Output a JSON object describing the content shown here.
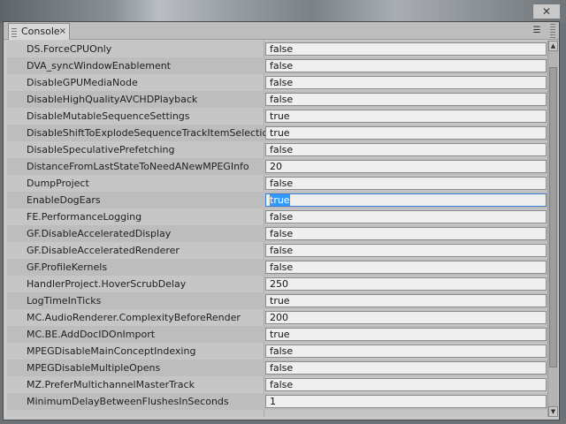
{
  "window": {
    "close_glyph": "✕"
  },
  "tab": {
    "label": "Console",
    "close_glyph": "×"
  },
  "panel_menu_glyph": "☰",
  "rows": [
    {
      "key": "DS.ForceCPUOnly",
      "value": "false"
    },
    {
      "key": "DVA_syncWindowEnablement",
      "value": "false"
    },
    {
      "key": "DisableGPUMediaNode",
      "value": "false"
    },
    {
      "key": "DisableHighQualityAVCHDPlayback",
      "value": "false"
    },
    {
      "key": "DisableMutableSequenceSettings",
      "value": "true"
    },
    {
      "key": "DisableShiftToExplodeSequenceTrackItemSelections",
      "value": "true"
    },
    {
      "key": "DisableSpeculativePrefetching",
      "value": "false"
    },
    {
      "key": "DistanceFromLastStateToNeedANewMPEGInfo",
      "value": "20"
    },
    {
      "key": "DumpProject",
      "value": "false"
    },
    {
      "key": "EnableDogEars",
      "value": "true",
      "selected": true
    },
    {
      "key": "FE.PerformanceLogging",
      "value": "false"
    },
    {
      "key": "GF.DisableAcceleratedDisplay",
      "value": "false"
    },
    {
      "key": "GF.DisableAcceleratedRenderer",
      "value": "false"
    },
    {
      "key": "GF.ProfileKernels",
      "value": "false"
    },
    {
      "key": "HandlerProject.HoverScrubDelay",
      "value": "250"
    },
    {
      "key": "LogTimeInTicks",
      "value": "true"
    },
    {
      "key": "MC.AudioRenderer.ComplexityBeforeRender",
      "value": "200"
    },
    {
      "key": "MC.BE.AddDocIDOnImport",
      "value": "true"
    },
    {
      "key": "MPEGDisableMainConceptIndexing",
      "value": "false"
    },
    {
      "key": "MPEGDisableMultipleOpens",
      "value": "false"
    },
    {
      "key": "MZ.PreferMultichannelMasterTrack",
      "value": "false"
    },
    {
      "key": "MinimumDelayBetweenFlushesInSeconds",
      "value": "1"
    }
  ]
}
